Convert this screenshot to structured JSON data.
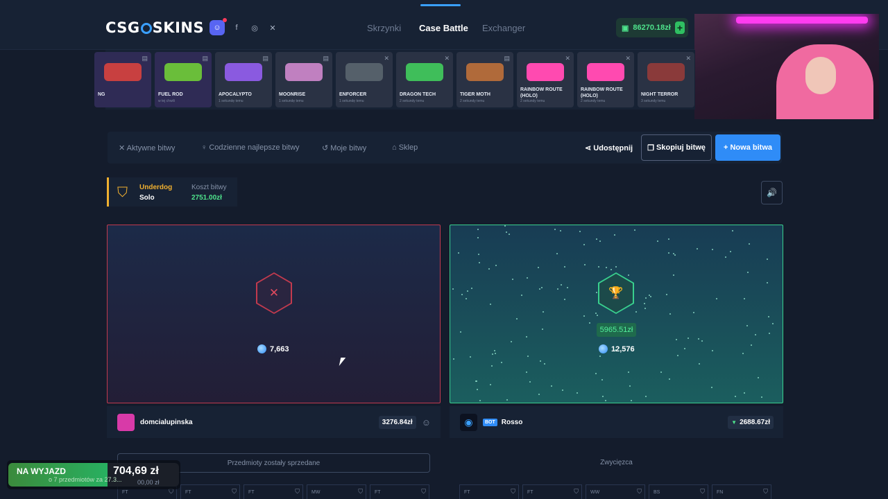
{
  "header": {
    "logo_left": "CSG",
    "logo_right": "SKINS",
    "nav": [
      {
        "label": "Skrzynki",
        "active": false
      },
      {
        "label": "Case Battle",
        "active": true
      },
      {
        "label": "Exchanger",
        "active": false
      }
    ],
    "balance": "86270.18zł",
    "balance_plus": "+"
  },
  "live_drops": [
    {
      "name": "NG",
      "time": "",
      "tint": "purple"
    },
    {
      "name": "FUEL ROD",
      "time": "w tej chwili",
      "tint": "purple"
    },
    {
      "name": "APOCALYPTO",
      "time": "1 sekundę temu",
      "tint": "grey"
    },
    {
      "name": "MOONRISE",
      "time": "1 sekundę temu",
      "tint": "grey"
    },
    {
      "name": "ENFORCER",
      "time": "1 sekundę temu",
      "tint": "grey"
    },
    {
      "name": "DRAGON TECH",
      "time": "2 sekundy temu",
      "tint": "grey"
    },
    {
      "name": "TIGER MOTH",
      "time": "2 sekundy temu",
      "tint": "grey"
    },
    {
      "name": "RAINBOW ROUTE (HOLO)",
      "time": "2 sekundy temu",
      "tint": "grey"
    },
    {
      "name": "RAINBOW ROUTE (HOLO)",
      "time": "2 sekundy temu",
      "tint": "grey"
    },
    {
      "name": "NIGHT TERROR",
      "time": "3 sekundy temu",
      "tint": "grey"
    }
  ],
  "subnav": {
    "tabs": [
      "Aktywne bitwy",
      "Codzienne najlepsze bitwy",
      "Moje bitwy",
      "Sklep"
    ],
    "share": "Udostępnij",
    "copy": "Skopiuj bitwę",
    "new_battle": "Nowa bitwa"
  },
  "battle_info": {
    "mode": "Underdog",
    "type": "Solo",
    "cost_label": "Koszt bitwy",
    "cost": "2751.00zł"
  },
  "players": [
    {
      "name": "domcialupinska",
      "coins": "7,663",
      "value": "3276.84zł",
      "result": "lose",
      "status_text": "Przedmioty zostały sprzedane",
      "conditions": [
        "FT",
        "FT",
        "FT",
        "MW",
        "FT"
      ]
    },
    {
      "name": "Rosso",
      "bot_badge": "BOT",
      "coins": "12,576",
      "win_amount": "5965.51zł",
      "value": "2688.67zł",
      "result": "win",
      "status_text": "Zwycięzca",
      "conditions": [
        "FT",
        "FT",
        "WW",
        "BS",
        "FN"
      ]
    }
  ],
  "overlay": {
    "label": "NA WYJAZD",
    "amount": "704,69 zł",
    "sub1": "o 7 przedmiotów za 27.3...",
    "sub2": "00,00 zł",
    "progress": 0.58
  },
  "colors": {
    "accent": "#2f8cf7",
    "win": "#39d08e",
    "lose": "#c23a4e",
    "gold": "#f0b030"
  }
}
